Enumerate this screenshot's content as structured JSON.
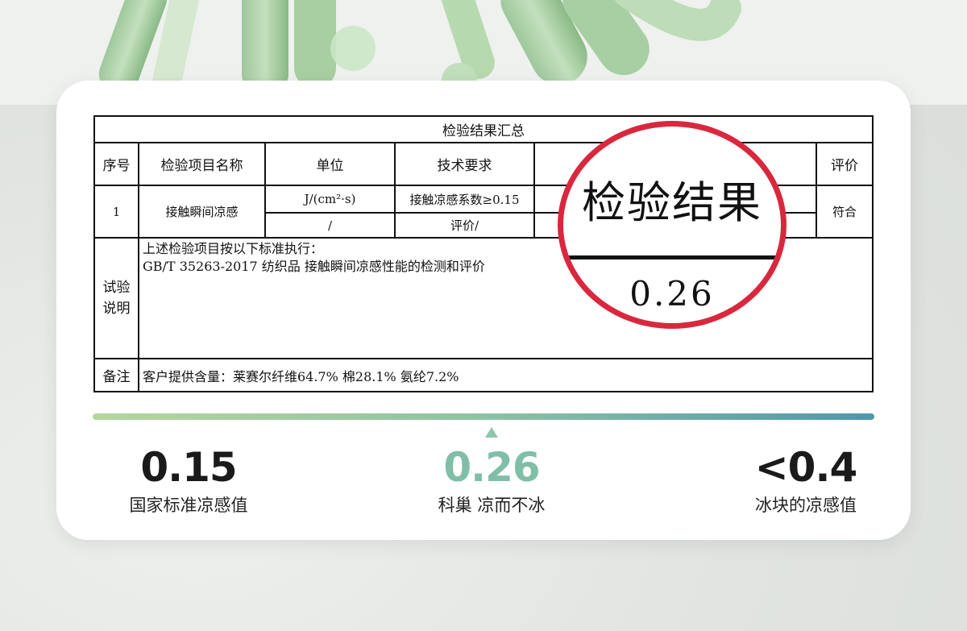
{
  "report": {
    "title": "检验结果汇总",
    "headers": {
      "seq": "序号",
      "item": "检验项目名称",
      "unit": "单位",
      "requirement": "技术要求",
      "rating": "评价"
    },
    "row1": {
      "seq": "1",
      "item": "接触瞬间凉感",
      "unit": "J/(cm²·s)",
      "requirement": "接触凉感系数≥0.15",
      "unit2": "/",
      "requirement2": "评价/",
      "rating": "符合"
    },
    "test_label": [
      "试验",
      "说明"
    ],
    "test_text": [
      "上述检验项目按以下标准执行：",
      "GB/T 35263-2017 纺织品 接触瞬间凉感性能的检测和评价"
    ],
    "note_label": "备注",
    "note_text": "客户提供含量：莱赛尔纤维64.7% 棉28.1% 氨纶7.2%"
  },
  "highlight": {
    "title": "检验结果",
    "value": "0.26",
    "ring_color": "#d9283d"
  },
  "scale": {
    "colors": [
      "#b4d79a",
      "#4f97ad"
    ],
    "marker_color": "#8fc6ae",
    "stats": [
      {
        "value": "0.15",
        "label": "国家标准凉感值"
      },
      {
        "value": "0.26",
        "label": "科巢 凉而不冰"
      },
      {
        "value": "<0.4",
        "label": "冰块的凉感值"
      }
    ]
  }
}
